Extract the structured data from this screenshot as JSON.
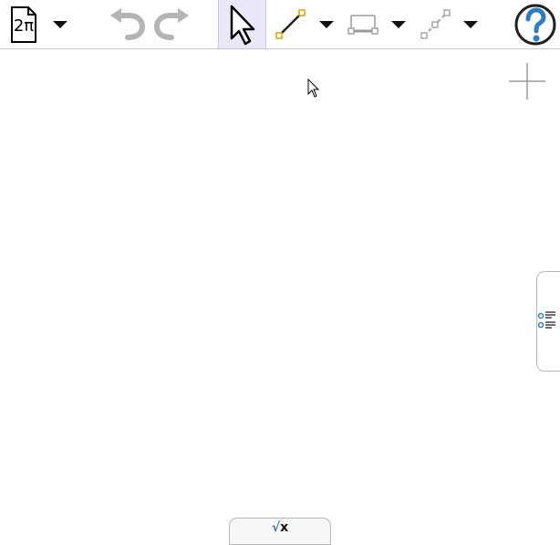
{
  "toolbar": {
    "document_button_label": "2π",
    "tools": [
      {
        "name": "document-menu",
        "icon": "document-icon"
      },
      {
        "name": "undo",
        "icon": "undo-icon",
        "enabled": false
      },
      {
        "name": "redo",
        "icon": "redo-icon",
        "enabled": false
      },
      {
        "name": "move",
        "icon": "pointer-arrow-icon",
        "selected": true
      },
      {
        "name": "segment",
        "icon": "segment-icon"
      },
      {
        "name": "rectangle-slider",
        "icon": "slider-icon",
        "enabled": false
      },
      {
        "name": "dashed-line",
        "icon": "dashed-segment-icon",
        "enabled": false
      },
      {
        "name": "help",
        "icon": "help-icon"
      }
    ]
  },
  "keyboard_tab": {
    "root_symbol": "√",
    "variable": "x"
  },
  "colors": {
    "help_blue": "#2e7dc4",
    "segment_point": "#d9a300",
    "disabled_gray": "#b4b4b4",
    "selected_bg": "#e8e8f8"
  }
}
